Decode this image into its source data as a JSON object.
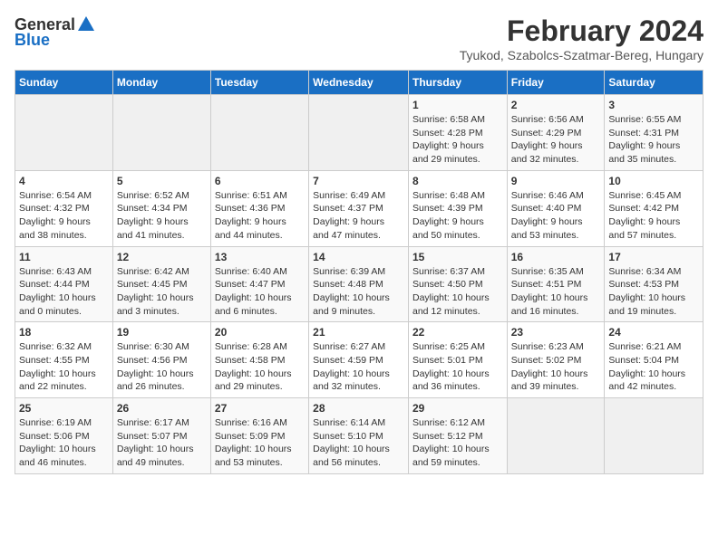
{
  "header": {
    "logo_general": "General",
    "logo_blue": "Blue",
    "main_title": "February 2024",
    "subtitle": "Tyukod, Szabolcs-Szatmar-Bereg, Hungary"
  },
  "calendar": {
    "headers": [
      "Sunday",
      "Monday",
      "Tuesday",
      "Wednesday",
      "Thursday",
      "Friday",
      "Saturday"
    ],
    "weeks": [
      [
        {
          "day": "",
          "info": ""
        },
        {
          "day": "",
          "info": ""
        },
        {
          "day": "",
          "info": ""
        },
        {
          "day": "",
          "info": ""
        },
        {
          "day": "1",
          "info": "Sunrise: 6:58 AM\nSunset: 4:28 PM\nDaylight: 9 hours\nand 29 minutes."
        },
        {
          "day": "2",
          "info": "Sunrise: 6:56 AM\nSunset: 4:29 PM\nDaylight: 9 hours\nand 32 minutes."
        },
        {
          "day": "3",
          "info": "Sunrise: 6:55 AM\nSunset: 4:31 PM\nDaylight: 9 hours\nand 35 minutes."
        }
      ],
      [
        {
          "day": "4",
          "info": "Sunrise: 6:54 AM\nSunset: 4:32 PM\nDaylight: 9 hours\nand 38 minutes."
        },
        {
          "day": "5",
          "info": "Sunrise: 6:52 AM\nSunset: 4:34 PM\nDaylight: 9 hours\nand 41 minutes."
        },
        {
          "day": "6",
          "info": "Sunrise: 6:51 AM\nSunset: 4:36 PM\nDaylight: 9 hours\nand 44 minutes."
        },
        {
          "day": "7",
          "info": "Sunrise: 6:49 AM\nSunset: 4:37 PM\nDaylight: 9 hours\nand 47 minutes."
        },
        {
          "day": "8",
          "info": "Sunrise: 6:48 AM\nSunset: 4:39 PM\nDaylight: 9 hours\nand 50 minutes."
        },
        {
          "day": "9",
          "info": "Sunrise: 6:46 AM\nSunset: 4:40 PM\nDaylight: 9 hours\nand 53 minutes."
        },
        {
          "day": "10",
          "info": "Sunrise: 6:45 AM\nSunset: 4:42 PM\nDaylight: 9 hours\nand 57 minutes."
        }
      ],
      [
        {
          "day": "11",
          "info": "Sunrise: 6:43 AM\nSunset: 4:44 PM\nDaylight: 10 hours\nand 0 minutes."
        },
        {
          "day": "12",
          "info": "Sunrise: 6:42 AM\nSunset: 4:45 PM\nDaylight: 10 hours\nand 3 minutes."
        },
        {
          "day": "13",
          "info": "Sunrise: 6:40 AM\nSunset: 4:47 PM\nDaylight: 10 hours\nand 6 minutes."
        },
        {
          "day": "14",
          "info": "Sunrise: 6:39 AM\nSunset: 4:48 PM\nDaylight: 10 hours\nand 9 minutes."
        },
        {
          "day": "15",
          "info": "Sunrise: 6:37 AM\nSunset: 4:50 PM\nDaylight: 10 hours\nand 12 minutes."
        },
        {
          "day": "16",
          "info": "Sunrise: 6:35 AM\nSunset: 4:51 PM\nDaylight: 10 hours\nand 16 minutes."
        },
        {
          "day": "17",
          "info": "Sunrise: 6:34 AM\nSunset: 4:53 PM\nDaylight: 10 hours\nand 19 minutes."
        }
      ],
      [
        {
          "day": "18",
          "info": "Sunrise: 6:32 AM\nSunset: 4:55 PM\nDaylight: 10 hours\nand 22 minutes."
        },
        {
          "day": "19",
          "info": "Sunrise: 6:30 AM\nSunset: 4:56 PM\nDaylight: 10 hours\nand 26 minutes."
        },
        {
          "day": "20",
          "info": "Sunrise: 6:28 AM\nSunset: 4:58 PM\nDaylight: 10 hours\nand 29 minutes."
        },
        {
          "day": "21",
          "info": "Sunrise: 6:27 AM\nSunset: 4:59 PM\nDaylight: 10 hours\nand 32 minutes."
        },
        {
          "day": "22",
          "info": "Sunrise: 6:25 AM\nSunset: 5:01 PM\nDaylight: 10 hours\nand 36 minutes."
        },
        {
          "day": "23",
          "info": "Sunrise: 6:23 AM\nSunset: 5:02 PM\nDaylight: 10 hours\nand 39 minutes."
        },
        {
          "day": "24",
          "info": "Sunrise: 6:21 AM\nSunset: 5:04 PM\nDaylight: 10 hours\nand 42 minutes."
        }
      ],
      [
        {
          "day": "25",
          "info": "Sunrise: 6:19 AM\nSunset: 5:06 PM\nDaylight: 10 hours\nand 46 minutes."
        },
        {
          "day": "26",
          "info": "Sunrise: 6:17 AM\nSunset: 5:07 PM\nDaylight: 10 hours\nand 49 minutes."
        },
        {
          "day": "27",
          "info": "Sunrise: 6:16 AM\nSunset: 5:09 PM\nDaylight: 10 hours\nand 53 minutes."
        },
        {
          "day": "28",
          "info": "Sunrise: 6:14 AM\nSunset: 5:10 PM\nDaylight: 10 hours\nand 56 minutes."
        },
        {
          "day": "29",
          "info": "Sunrise: 6:12 AM\nSunset: 5:12 PM\nDaylight: 10 hours\nand 59 minutes."
        },
        {
          "day": "",
          "info": ""
        },
        {
          "day": "",
          "info": ""
        }
      ]
    ]
  }
}
